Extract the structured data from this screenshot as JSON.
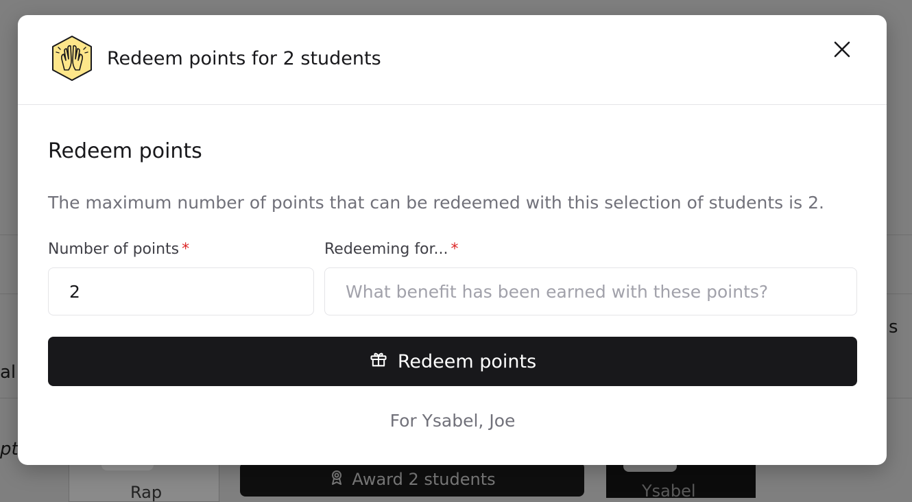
{
  "background": {
    "award_button_label": "Award 2 students",
    "card_label_rap": "Rap",
    "card_label_ysabel": "Ysabel",
    "partial_text_al": "al",
    "partial_text_pt": "pt",
    "partial_text_s": "s"
  },
  "modal": {
    "title": "Redeem points for 2 students",
    "close_label": "Close",
    "section_title": "Redeem points",
    "description": "The maximum number of points that can be redeemed with this selection of students is 2.",
    "points_field": {
      "label": "Number of points",
      "required_marker": "*",
      "value": "2"
    },
    "reason_field": {
      "label": "Redeeming for...",
      "required_marker": "*",
      "value": "",
      "placeholder": "What benefit has been earned with these points?"
    },
    "submit_label": "Redeem points",
    "for_text": "For Ysabel, Joe"
  },
  "icons": {
    "modal_icon": "high-five-hexagon-icon",
    "close": "close-icon",
    "submit": "gift-icon",
    "award": "award-ribbon-icon"
  },
  "colors": {
    "primary": "#18181b",
    "required": "#dc2626",
    "badge_fill": "#fde68a"
  }
}
